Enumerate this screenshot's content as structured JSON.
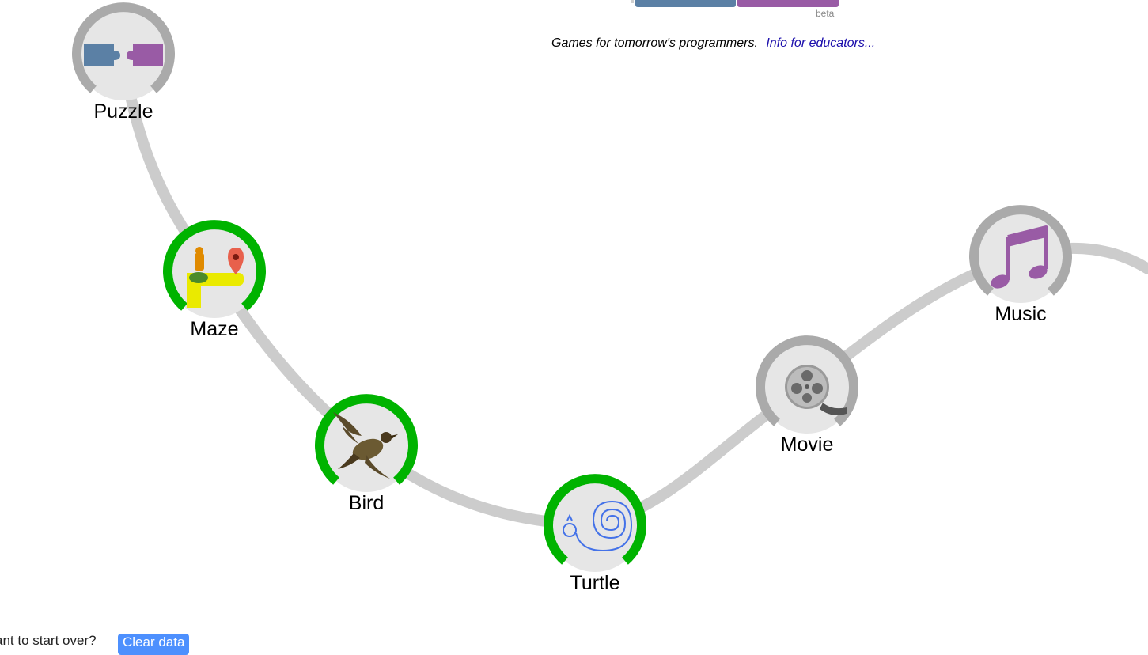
{
  "header": {
    "beta_label": "beta",
    "tagline": "Games for tomorrow's programmers.",
    "educators_link": "Info for educators...",
    "logo_colors": [
      "#5b80a5",
      "#995ba5"
    ]
  },
  "apps": [
    {
      "label": "Puzzle",
      "icon": "puzzle-icon",
      "completed": false
    },
    {
      "label": "Maze",
      "icon": "maze-icon",
      "completed": true
    },
    {
      "label": "Bird",
      "icon": "bird-icon",
      "completed": true
    },
    {
      "label": "Turtle",
      "icon": "turtle-icon",
      "completed": true
    },
    {
      "label": "Movie",
      "icon": "movie-icon",
      "completed": false
    },
    {
      "label": "Music",
      "icon": "music-icon",
      "completed": false
    }
  ],
  "colors": {
    "completed_ring": "#00b300",
    "incomplete_ring": "#aaaaaa",
    "path": "#cccccc",
    "link": "#1a0dab",
    "button": "#4d90fe"
  },
  "footer": {
    "prompt": "ant to start over?",
    "clear_button": "Clear data"
  }
}
